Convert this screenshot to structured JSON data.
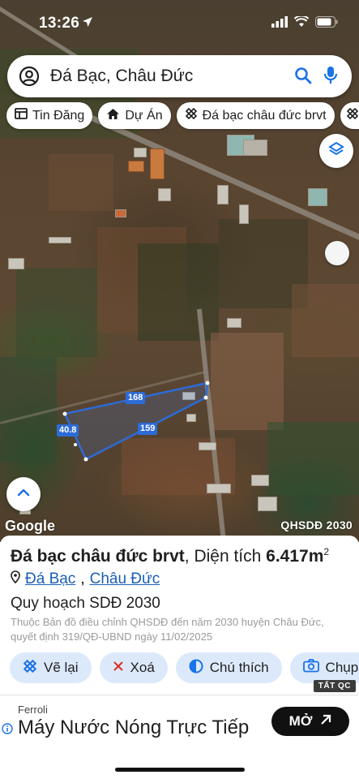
{
  "status_bar": {
    "time": "13:26"
  },
  "search": {
    "query": "Đá Bạc, Châu Đức"
  },
  "chips": [
    {
      "label": "Tin Đăng",
      "icon": "news-icon"
    },
    {
      "label": "Dự Án",
      "icon": "home-icon"
    },
    {
      "label": "Đá bạc châu đức brvt",
      "icon": "planning-icon"
    }
  ],
  "map": {
    "watermark": "Google",
    "overlay_label": "QHSDĐ 2030",
    "plot_dimensions": {
      "top": "168",
      "bottom": "159",
      "left": "40.8"
    }
  },
  "place": {
    "name": "Đá bạc châu đức brvt",
    "area_prefix": "Diện tích",
    "area_value": "6.417m",
    "area_unit_sup": "2",
    "location_1": "Đá Bạc",
    "location_2": "Châu Đức",
    "plan_title": "Quy hoạch SDĐ 2030",
    "desc_line1": "Thuộc Bản đồ điều chỉnh QHSDĐ đến năm 2030 huyện Châu Đức,",
    "desc_line2": "quyết định 319/QĐ-UBND ngày 11/02/2025"
  },
  "actions": [
    {
      "label": "Vẽ lại",
      "icon": "redraw-icon"
    },
    {
      "label": "Xoá",
      "icon": "close-icon"
    },
    {
      "label": "Chú thích",
      "icon": "contrast-icon"
    },
    {
      "label": "Chụp",
      "icon": "camera-icon"
    }
  ],
  "ad": {
    "label_tag": "TẤT QC",
    "brand": "Ferroli",
    "title": "Máy Nước Nóng Trực Tiếp",
    "cta": "MỞ"
  },
  "colors": {
    "accent_blue": "#1a73e8",
    "plot_line": "#2d6bd6",
    "action_bg": "#dce9fb"
  }
}
